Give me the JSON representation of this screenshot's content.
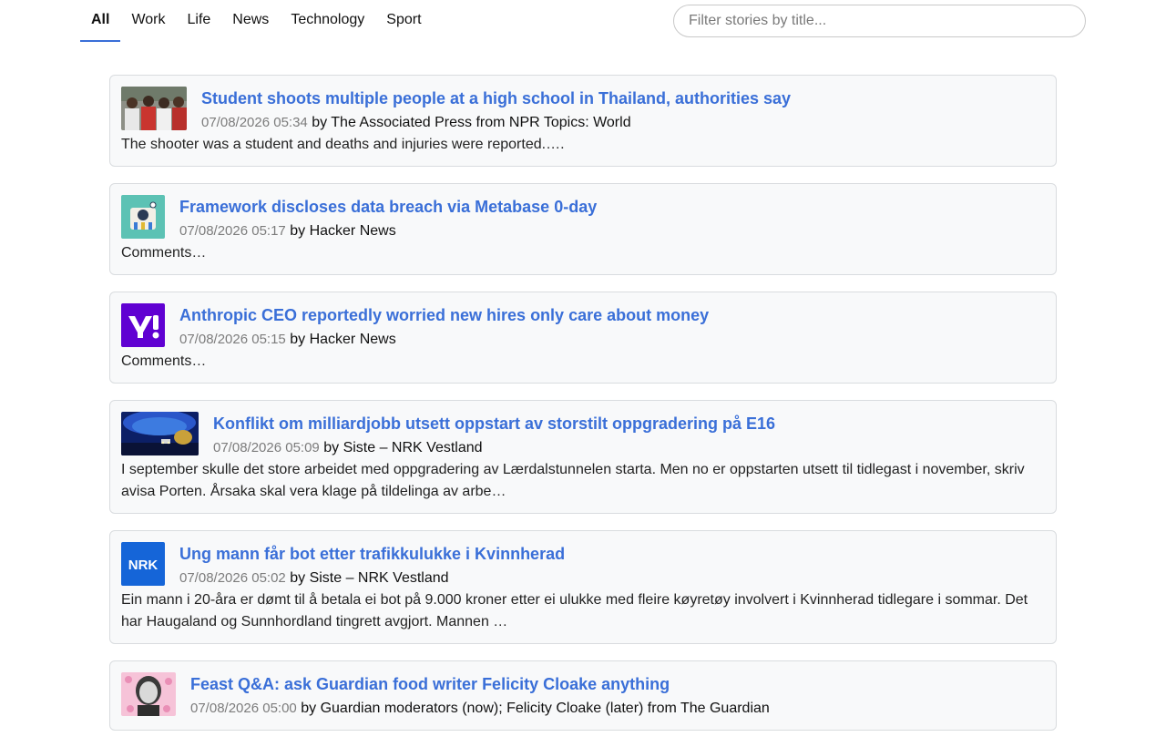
{
  "nav": {
    "tabs": [
      {
        "label": "All",
        "active": true
      },
      {
        "label": "Work"
      },
      {
        "label": "Life"
      },
      {
        "label": "News"
      },
      {
        "label": "Technology"
      },
      {
        "label": "Sport"
      }
    ],
    "search_placeholder": "Filter stories by title..."
  },
  "stories": [
    {
      "title": "Student shoots multiple people at a high school in Thailand, authorities say",
      "date": "07/08/2026 05:34",
      "byline": " by The Associated Press from NPR Topics: World",
      "summary": "The shooter was a student and deaths and injuries were reported.….",
      "thumb": "school-photo"
    },
    {
      "title": "Framework discloses data breach via Metabase 0-day",
      "date": "07/08/2026 05:17",
      "byline": " by Hacker News",
      "summary": "Comments…",
      "thumb": "framework-logo"
    },
    {
      "title": "Anthropic CEO reportedly worried new hires only care about money",
      "date": "07/08/2026 05:15",
      "byline": " by Hacker News",
      "summary": "Comments…",
      "thumb": "yahoo-logo"
    },
    {
      "title": "Konflikt om milliardjobb utsett oppstart av storstilt oppgradering på E16",
      "date": "07/08/2026 05:09",
      "byline": " by Siste – NRK Vestland",
      "summary": "I september skulle det store arbeidet med oppgradering av Lærdalstunnelen starta. Men no er oppstarten utsett til tidlegast i november, skriv avisa Porten. Årsaka skal vera klage på tildelinga av arbe…",
      "thumb": "tunnel-photo"
    },
    {
      "title": "Ung mann får bot etter trafikkulukke i Kvinnherad",
      "date": "07/08/2026 05:02",
      "byline": " by Siste – NRK Vestland",
      "summary": "Ein mann i 20-åra er dømt til å betala ei bot på 9.000 kroner etter ei ulukke med fleire køyretøy involvert i Kvinnherad tidlegare i sommar. Det har Haugaland og Sunnhordland tingrett avgjort. Mannen …",
      "thumb": "nrk-logo",
      "logo_text": "NRK"
    },
    {
      "title": "Feast Q&A: ask Guardian food writer Felicity Cloake anything",
      "date": "07/08/2026 05:00",
      "byline": " by Guardian moderators (now); Felicity Cloake (later) from The Guardian",
      "summary": "",
      "thumb": "portrait-photo"
    }
  ]
}
